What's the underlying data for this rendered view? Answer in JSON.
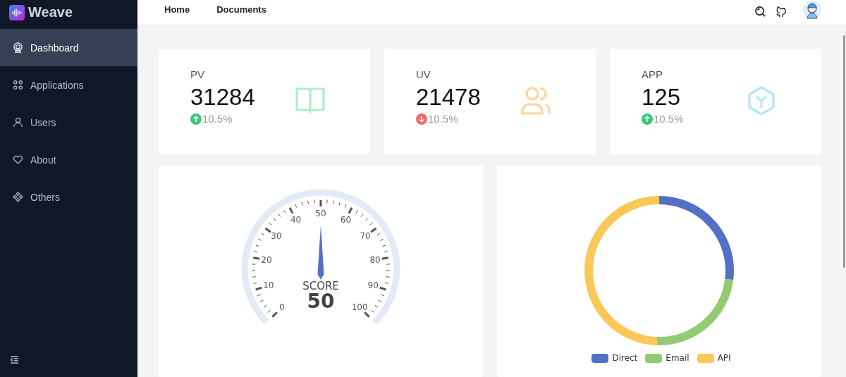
{
  "sidebar": {
    "brand": "Weave",
    "items": [
      {
        "label": "Dashboard",
        "selected": true
      },
      {
        "label": "Applications",
        "selected": false
      },
      {
        "label": "Users",
        "selected": false
      },
      {
        "label": "About",
        "selected": false
      },
      {
        "label": "Others",
        "selected": false
      }
    ]
  },
  "header": {
    "links": [
      {
        "label": "Home"
      },
      {
        "label": "Documents"
      }
    ]
  },
  "stats": [
    {
      "label": "PV",
      "value": "31284",
      "kind": "up",
      "change": "10.5%",
      "color": "#a7f0c8"
    },
    {
      "label": "UV",
      "value": "21478",
      "kind": "down",
      "change": "10.5%",
      "color": "#fbd5a0"
    },
    {
      "label": "APP",
      "value": "125",
      "kind": "up",
      "change": "10.5%",
      "color": "#b8e4f9"
    }
  ],
  "gauge": {
    "title": "SCORE",
    "value": "50",
    "level": 0.5,
    "tick_labels": [
      "0",
      "10",
      "20",
      "30",
      "40",
      "50",
      "60",
      "70",
      "80",
      "90",
      "100"
    ]
  },
  "donut": {
    "legend": [
      {
        "label": "Direct",
        "color": "#5470c6"
      },
      {
        "label": "Email",
        "color": "#91cc75"
      },
      {
        "label": "API",
        "color": "#fac858"
      }
    ]
  }
}
